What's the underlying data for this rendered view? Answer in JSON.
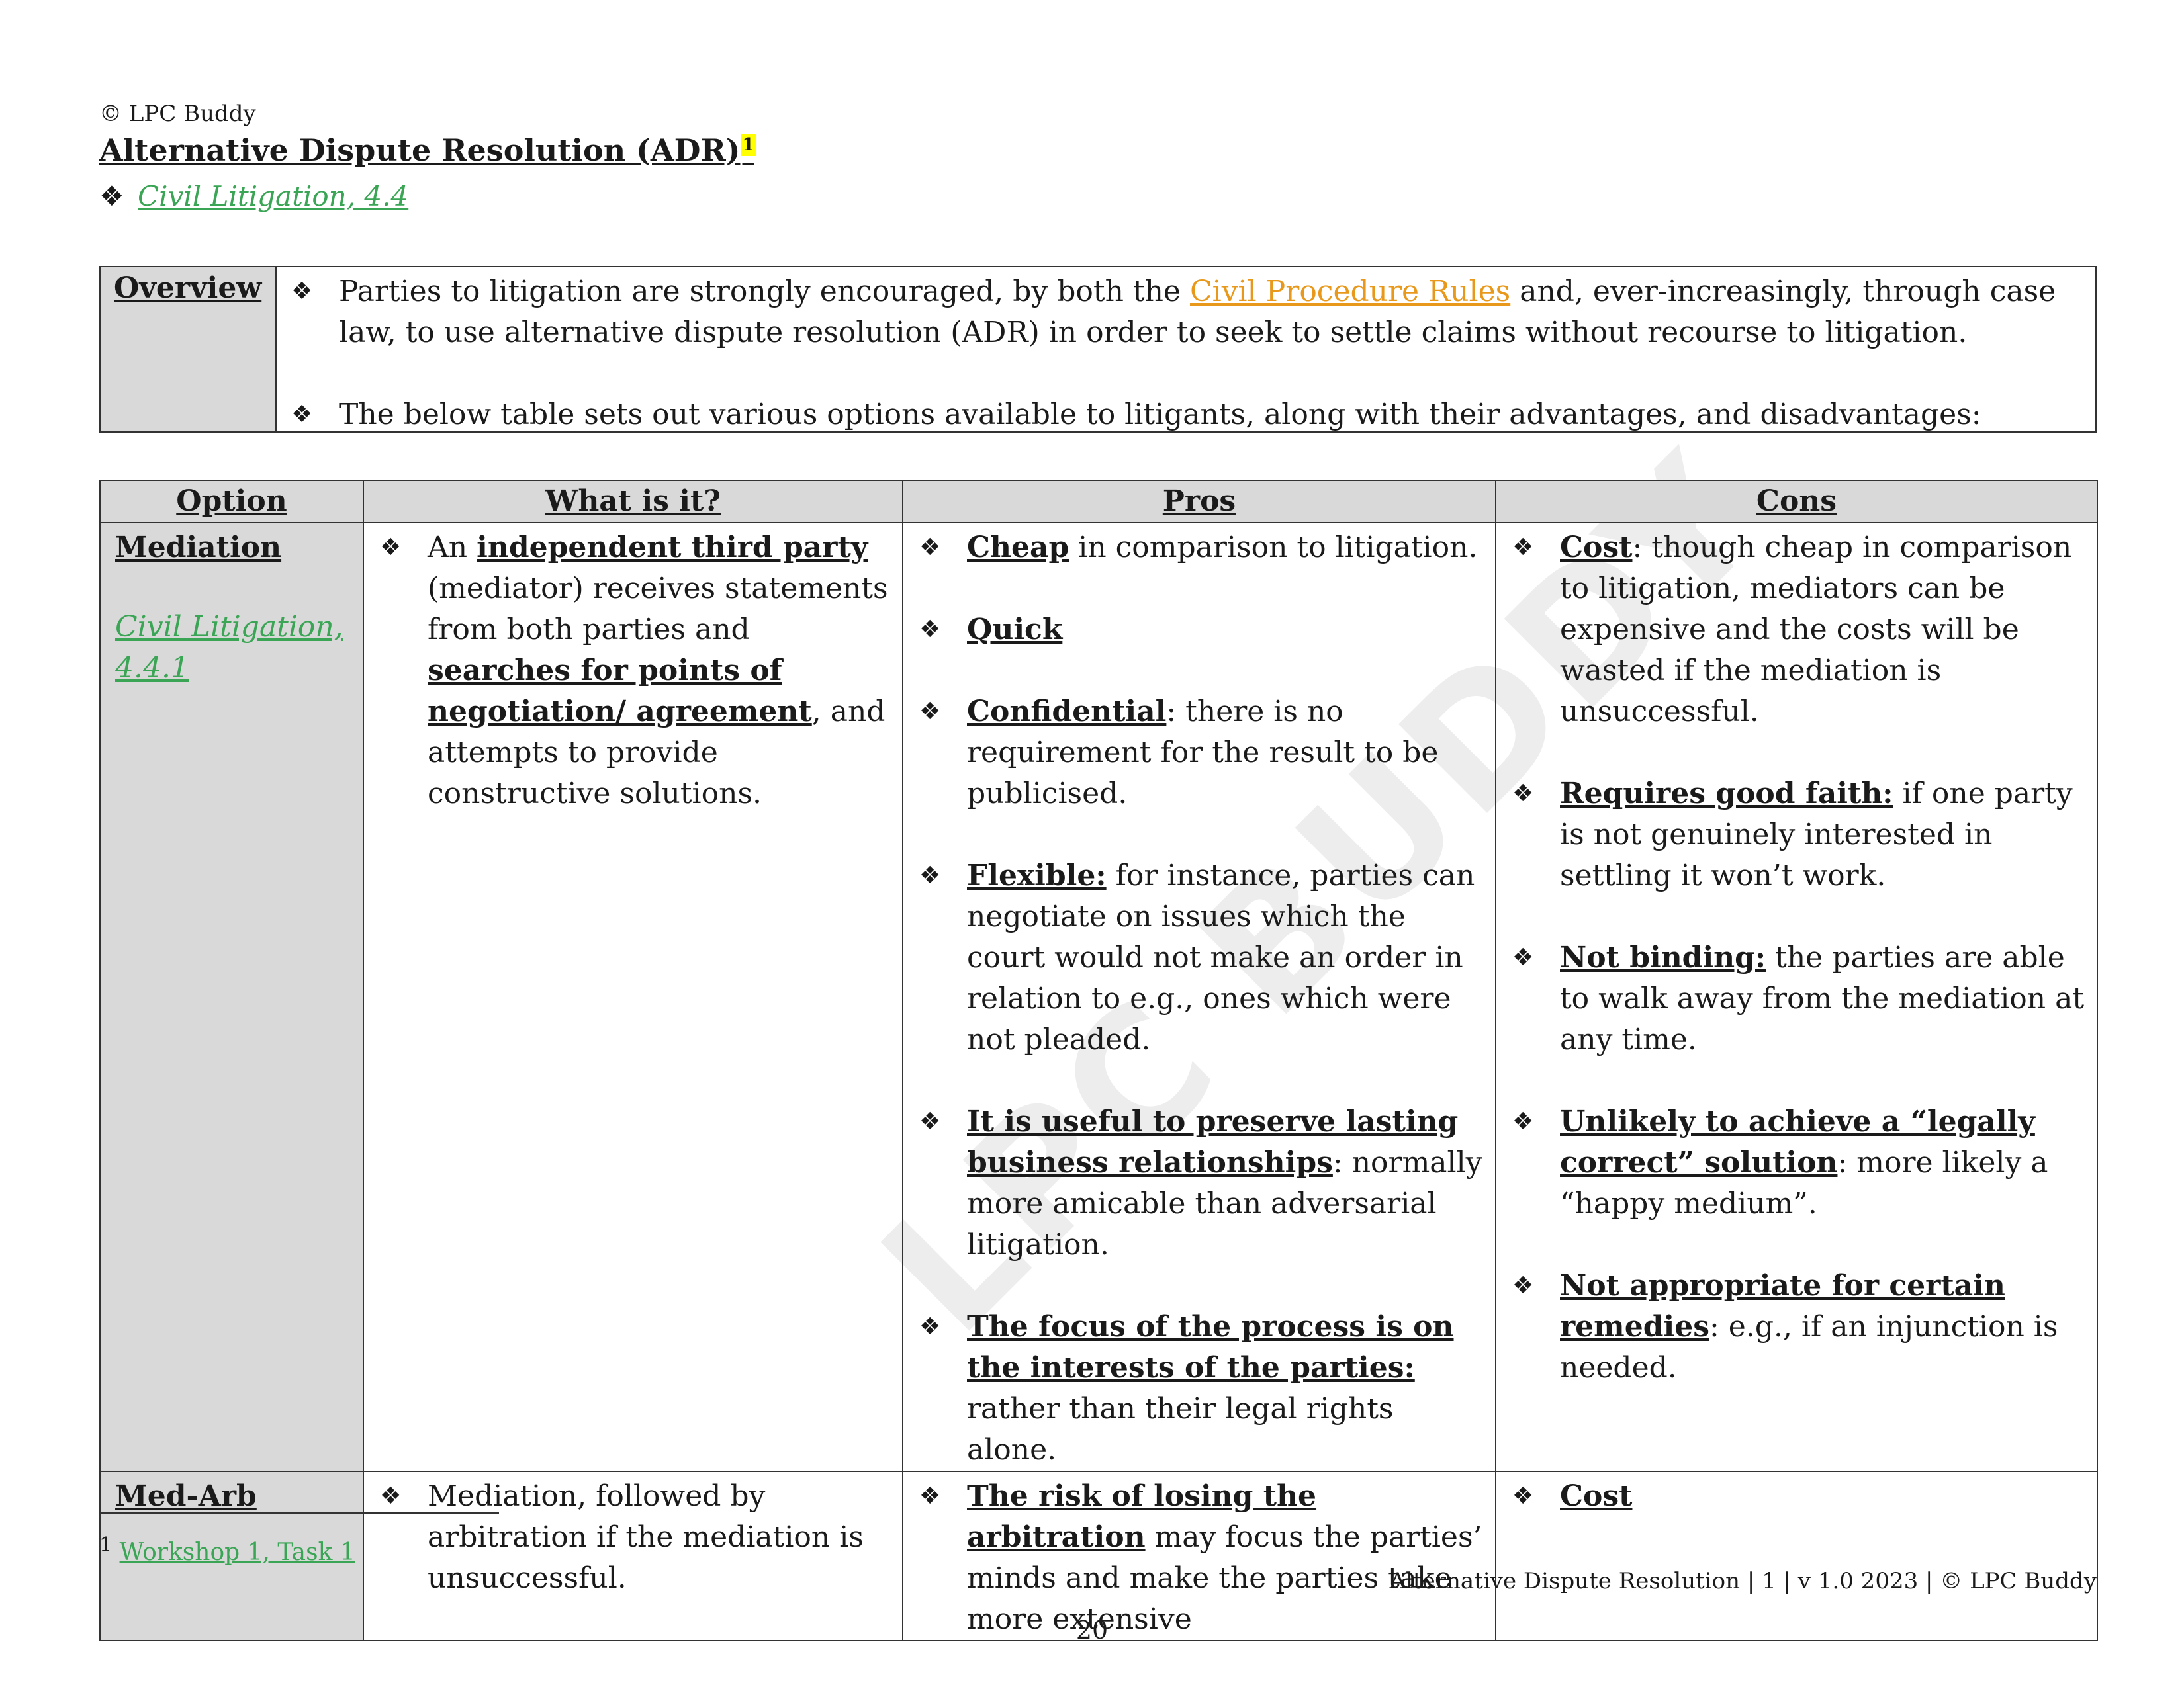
{
  "header": {
    "copyright": "© LPC Buddy",
    "title": "Alternative Dispute Resolution (ADR)",
    "footnote_marker": "1",
    "sublink": "Civil Litigation, 4.4"
  },
  "overview": {
    "label": "Overview",
    "bullet1_pre": "Parties to litigation are strongly encouraged, by both the ",
    "bullet1_link": "Civil Procedure Rules",
    "bullet1_post": " and, ever-increasingly, through case law, to use alternative dispute resolution (ADR) in order to seek to settle claims without recourse to litigation.",
    "bullet2": "The below table sets out various options available to litigants, along with their advantages, and disadvantages:"
  },
  "table": {
    "headers": [
      "Option",
      "What is it?",
      "Pros",
      "Cons"
    ],
    "mediation": {
      "name": "Mediation",
      "link": "Civil Litigation, 4.4.1",
      "what_1": "An ",
      "what_2": "independent third party",
      "what_3": " (mediator) receives statements from both parties and ",
      "what_4": "searches for points of negotiation/ agreement",
      "what_5": ", and attempts to provide constructive solutions.",
      "pros": [
        {
          "bold": "Cheap",
          "text": " in comparison to litigation."
        },
        {
          "bold": "Quick",
          "text": ""
        },
        {
          "bold": "Confidential",
          "text": ": there is no requirement for the result to be publicised."
        },
        {
          "bold": "Flexible:",
          "text": " for instance, parties can negotiate on issues which the court would not make an order in relation to e.g., ones which were not pleaded."
        },
        {
          "bold": "It is useful to preserve lasting business relationships",
          "text": ": normally more amicable than adversarial litigation."
        },
        {
          "bold": "The focus of the process is on the interests of the parties:",
          "text": " rather than their legal rights alone."
        }
      ],
      "cons": [
        {
          "bold": "Cost",
          "text": ": though cheap in comparison to litigation, mediators can be expensive and the costs will be wasted if the mediation is unsuccessful."
        },
        {
          "bold": "Requires good faith:",
          "text": " if one party is not genuinely interested in settling it won’t work."
        },
        {
          "bold": "Not binding:",
          "text": " the parties are able to walk away from the mediation at any time."
        },
        {
          "bold": "Unlikely to achieve a “legally correct” solution",
          "text": ": more likely a “happy medium”."
        },
        {
          "bold": "Not appropriate for certain remedies",
          "text": ": e.g., if an injunction is needed."
        }
      ]
    },
    "medarb": {
      "name": "Med-Arb",
      "what": "Mediation, followed by arbitration if the mediation is unsuccessful.",
      "pros_bold": "The risk of losing the arbitration",
      "pros_text": " may focus the parties’ minds and make the parties take more extensive",
      "cons_bold": "Cost"
    }
  },
  "watermark": "LPC BUDDY",
  "footnote": {
    "marker": "1",
    "link": "Workshop 1, Task 1"
  },
  "footer": {
    "text": "Alternative Dispute Resolution | 1 | v 1.0 2023 | © LPC Buddy",
    "page": "20"
  },
  "bullet_glyph": "❖"
}
